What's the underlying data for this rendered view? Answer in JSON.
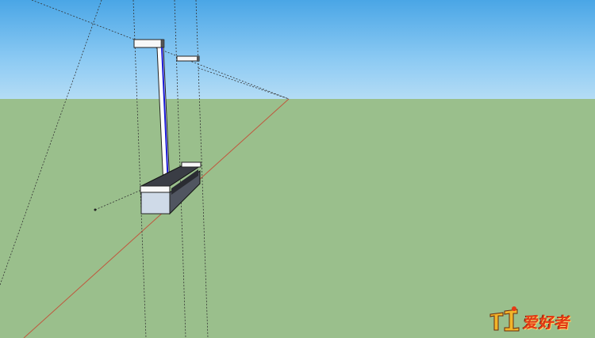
{
  "app": {
    "type": "3d-modeling-viewport"
  },
  "scene": {
    "sky_color": "#8ccaf3",
    "ground_color": "#9abf8c",
    "red_axis_color": "#c0583e",
    "blue_axis_color": "#1a1ad6",
    "guide_line_color": "#333333"
  },
  "watermark": {
    "text": "爱好者",
    "icon": "carpenter-logo-icon",
    "color": "#e53b16"
  }
}
